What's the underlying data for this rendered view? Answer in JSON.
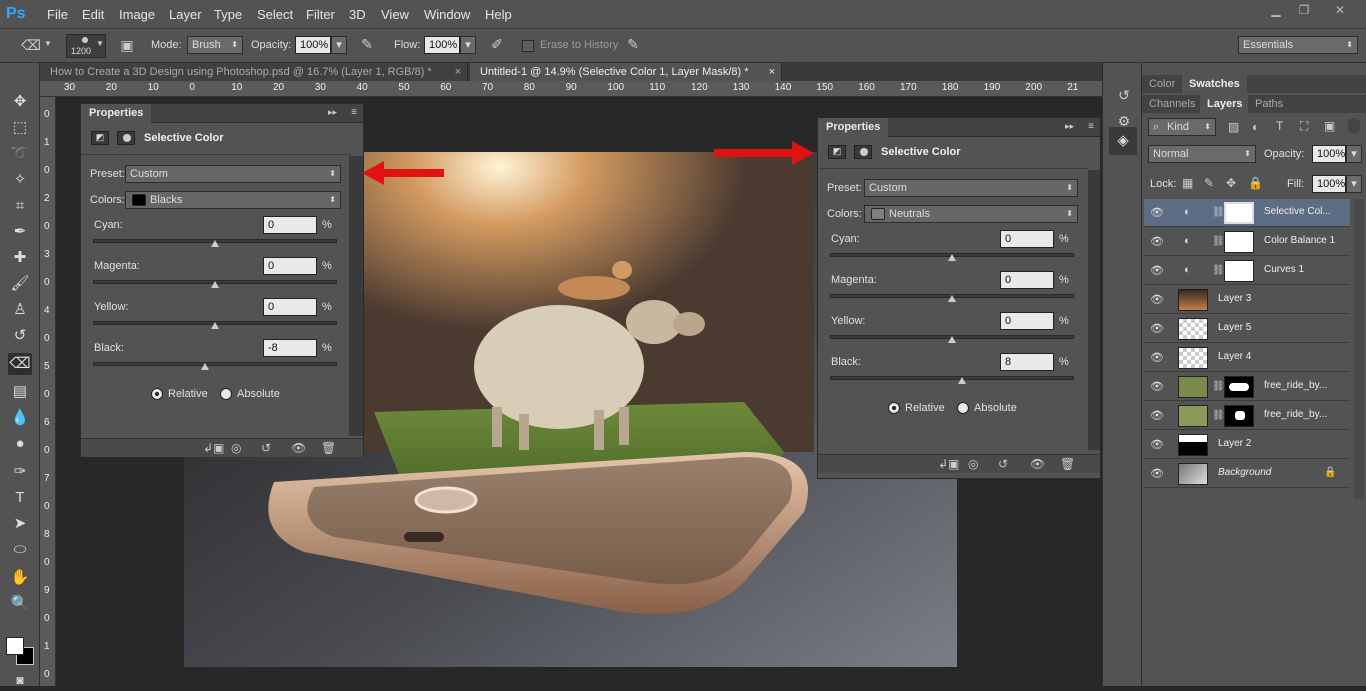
{
  "app": {
    "logo": "Ps"
  },
  "menu": {
    "items": [
      "File",
      "Edit",
      "Image",
      "Layer",
      "Type",
      "Select",
      "Filter",
      "3D",
      "View",
      "Window",
      "Help"
    ]
  },
  "window_controls": [
    "minimize-icon",
    "restore-icon",
    "close-icon"
  ],
  "options": {
    "brush_size": "1200",
    "mode_label": "Mode:",
    "mode_value": "Brush",
    "opacity_label": "Opacity:",
    "opacity_value": "100%",
    "flow_label": "Flow:",
    "flow_value": "100%",
    "erase_history_label": "Erase to History",
    "workspace": "Essentials"
  },
  "doc_tabs": [
    {
      "label": "How to Create a 3D Design using Photoshop.psd @ 16.7% (Layer 1, RGB/8) *",
      "active": false
    },
    {
      "label": "Untitled-1 @ 14.9% (Selective Color 1, Layer Mask/8) *",
      "active": true
    }
  ],
  "ruler_h": [
    "30",
    "20",
    "10",
    "0",
    "10",
    "20",
    "30",
    "40",
    "50",
    "60",
    "70",
    "80",
    "90",
    "100",
    "110",
    "120",
    "130",
    "140",
    "150",
    "160",
    "170",
    "180",
    "190",
    "200",
    "21"
  ],
  "ruler_v": [
    "0",
    "1",
    "0",
    "2",
    "0",
    "3",
    "0",
    "4",
    "0",
    "5",
    "0",
    "6",
    "0",
    "7",
    "0",
    "8",
    "0",
    "9",
    "0",
    "1",
    "0"
  ],
  "panel_left": {
    "tab": "Properties",
    "title": "Selective Color",
    "preset_label": "Preset:",
    "preset_value": "Custom",
    "colors_label": "Colors:",
    "colors_value": "Blacks",
    "colors_swatch": "#000000",
    "sliders": [
      {
        "label": "Cyan:",
        "value": "0"
      },
      {
        "label": "Magenta:",
        "value": "0"
      },
      {
        "label": "Yellow:",
        "value": "0"
      },
      {
        "label": "Black:",
        "value": "-8"
      }
    ],
    "percent": "%",
    "relative": "Relative",
    "absolute": "Absolute",
    "method": "relative"
  },
  "panel_right": {
    "tab": "Properties",
    "title": "Selective Color",
    "preset_label": "Preset:",
    "preset_value": "Custom",
    "colors_label": "Colors:",
    "colors_value": "Neutrals",
    "colors_swatch": "#808080",
    "sliders": [
      {
        "label": "Cyan:",
        "value": "0"
      },
      {
        "label": "Magenta:",
        "value": "0"
      },
      {
        "label": "Yellow:",
        "value": "0"
      },
      {
        "label": "Black:",
        "value": "8"
      }
    ],
    "percent": "%",
    "relative": "Relative",
    "absolute": "Absolute",
    "method": "relative"
  },
  "color_tabs": [
    "Color",
    "Swatches"
  ],
  "layer_tabs": [
    "Channels",
    "Layers",
    "Paths"
  ],
  "layers_panel": {
    "kind": "Kind",
    "blend": "Normal",
    "opacity_label": "Opacity:",
    "opacity_value": "100%",
    "lock_label": "Lock:",
    "fill_label": "Fill:",
    "fill_value": "100%"
  },
  "layers": [
    {
      "name": "Selective Col...",
      "type": "adjustment",
      "selected": true
    },
    {
      "name": "Color Balance 1",
      "type": "adjustment",
      "selected": false
    },
    {
      "name": "Curves 1",
      "type": "adjustment",
      "selected": false
    },
    {
      "name": "Layer 3",
      "type": "pixel",
      "selected": false
    },
    {
      "name": "Layer 5",
      "type": "pixel",
      "selected": false
    },
    {
      "name": "Layer 4",
      "type": "pixel",
      "selected": false
    },
    {
      "name": "free_ride_by...",
      "type": "masked",
      "selected": false
    },
    {
      "name": "free_ride_by...",
      "type": "masked",
      "selected": false
    },
    {
      "name": "Layer 2",
      "type": "pixel",
      "selected": false
    },
    {
      "name": "Background",
      "type": "background",
      "selected": false
    }
  ],
  "colors": {
    "accent": "#31a8ff",
    "arrow": "#e01212",
    "selected_layer": "#5c6c85"
  }
}
